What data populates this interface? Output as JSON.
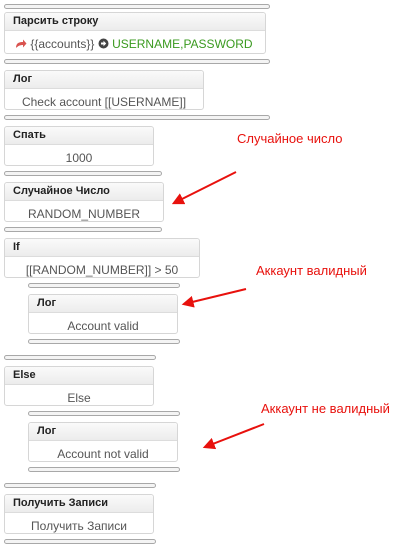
{
  "blocks": [
    {
      "title": "Парсить строку",
      "tokens": {
        "accounts": "{{accounts}}",
        "fields": "USERNAME,PASSWORD"
      }
    },
    {
      "title": "Лог",
      "body": "Check account [[USERNAME]]"
    },
    {
      "title": "Спать",
      "body": "1000"
    },
    {
      "title": "Случайное Число",
      "body": "RANDOM_NUMBER"
    },
    {
      "title": "If",
      "body": "[[RANDOM_NUMBER]] > 50"
    },
    {
      "title": "Лог",
      "body": "Account valid"
    },
    {
      "title": "Else",
      "body": "Else"
    },
    {
      "title": "Лог",
      "body": "Account not valid"
    },
    {
      "title": "Получить Записи",
      "body": "Получить Записи"
    }
  ],
  "annotations": {
    "random": "Случайное число",
    "valid": "Аккаунт валидный",
    "invalid": "Аккаунт не валидный"
  },
  "icons": {
    "share": "share-arrow-icon",
    "next": "right-arrow-circle-icon",
    "annotation_arrow": "red-arrow-icon"
  },
  "colors": {
    "annotation": "#e8110d",
    "field_green": "#3a9a1f",
    "share_red": "#d9534f"
  }
}
